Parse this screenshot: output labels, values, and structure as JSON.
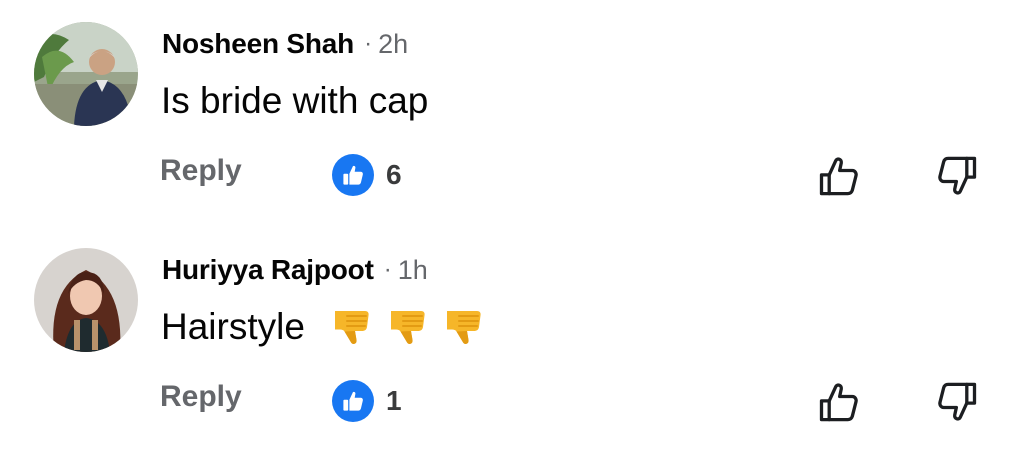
{
  "comments": [
    {
      "author": "Nosheen Shah",
      "separator": "·",
      "time": "2h",
      "text": "Is bride with cap",
      "emojis": [],
      "reply_label": "Reply",
      "like_count": "6"
    },
    {
      "author": "Huriyya Rajpoot",
      "separator": "·",
      "time": "1h",
      "text": "Hairstyle",
      "emojis": [
        "thumbs-down-emoji",
        "thumbs-down-emoji",
        "thumbs-down-emoji"
      ],
      "reply_label": "Reply",
      "like_count": "1"
    }
  ],
  "colors": {
    "like_blue": "#1877f2",
    "secondary_text": "#65676b",
    "emoji_yellow": "#f6b629"
  },
  "icons": {
    "like_badge": "like-badge-icon",
    "thumb_up": "thumbs-up-outline-icon",
    "thumb_down": "thumbs-down-outline-icon"
  }
}
